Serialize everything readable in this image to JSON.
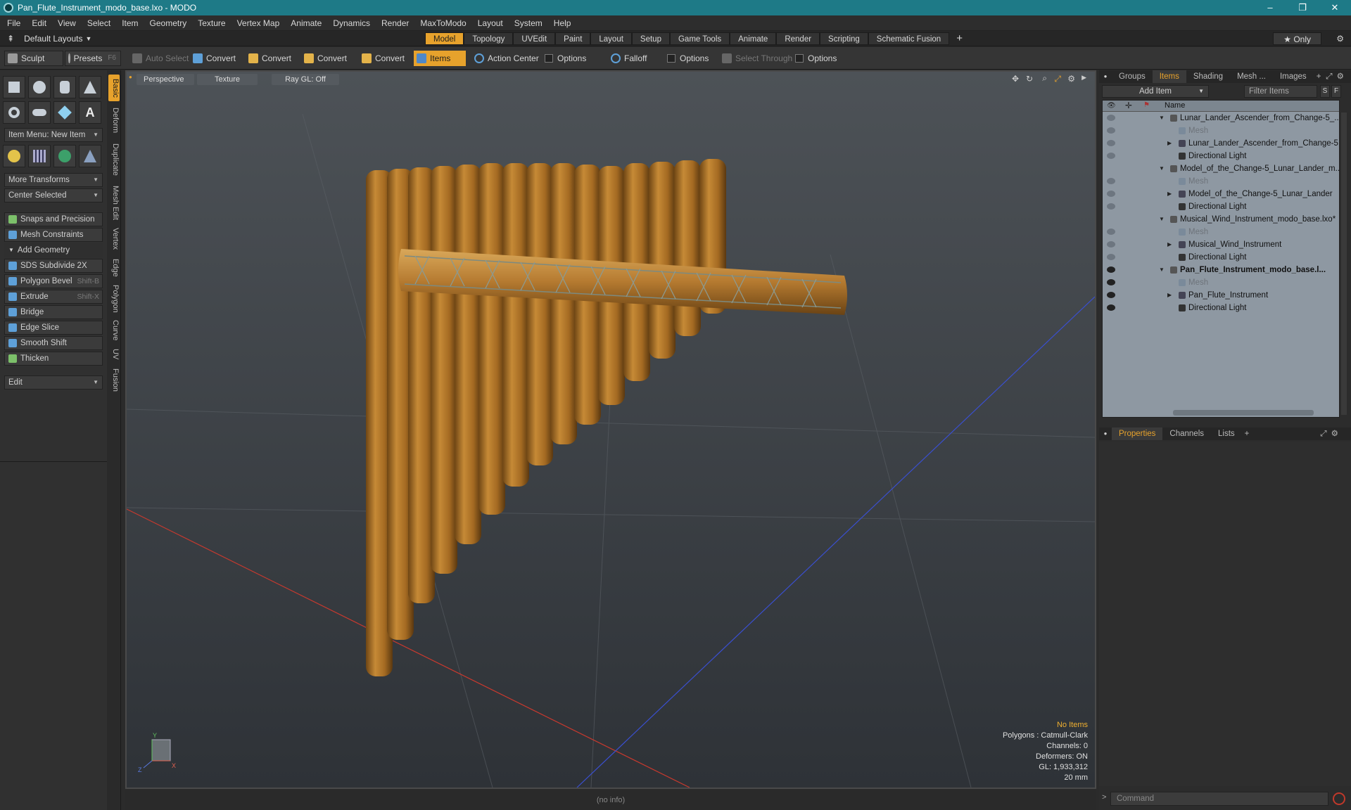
{
  "window": {
    "title": "Pan_Flute_Instrument_modo_base.lxo - MODO",
    "controls": [
      "–",
      "❐",
      "✕"
    ]
  },
  "menu": [
    "File",
    "Edit",
    "View",
    "Select",
    "Item",
    "Geometry",
    "Texture",
    "Vertex Map",
    "Animate",
    "Dynamics",
    "Render",
    "MaxToModo",
    "Layout",
    "System",
    "Help"
  ],
  "layoutbar": {
    "layouts_label": "Default Layouts",
    "tabs": [
      "Model",
      "Topology",
      "UVEdit",
      "Paint",
      "Layout",
      "Setup",
      "Game Tools",
      "Animate",
      "Render",
      "Scripting",
      "Schematic Fusion"
    ],
    "active_tab": "Model",
    "add_symbol": "+",
    "only_label": "★  Only"
  },
  "toolbar": {
    "sculpt": "Sculpt",
    "presets": "Presets",
    "presets_shortcut": "F6",
    "auto_select": "Auto Select",
    "convert": "Convert",
    "items": "Items",
    "action_center": "Action Center",
    "options": "Options",
    "falloff": "Falloff",
    "select_through": "Select Through"
  },
  "leftpanel": {
    "item_menu": "Item Menu: New Item",
    "more_transforms": "More Transforms",
    "center_selected": "Center Selected",
    "snaps": "Snaps and Precision",
    "mesh_constraints": "Mesh Constraints",
    "add_geometry": "Add Geometry",
    "tools": [
      {
        "label": "SDS Subdivide 2X",
        "shortcut": ""
      },
      {
        "label": "Polygon Bevel",
        "shortcut": "Shift-B"
      },
      {
        "label": "Extrude",
        "shortcut": "Shift-X"
      },
      {
        "label": "Bridge",
        "shortcut": ""
      },
      {
        "label": "Edge Slice",
        "shortcut": ""
      },
      {
        "label": "Smooth Shift",
        "shortcut": ""
      },
      {
        "label": "Thicken",
        "shortcut": ""
      }
    ],
    "edit": "Edit",
    "vtabs": [
      "Basic",
      "Deform",
      "Duplicate",
      "Mesh Edit",
      "Vertex",
      "Edge",
      "Polygon",
      "Curve",
      "UV",
      "Fusion"
    ]
  },
  "viewport": {
    "view_mode": "Perspective",
    "shading": "Texture",
    "raygl": "Ray GL: Off",
    "info": {
      "items": "No Items",
      "polygons": "Polygons : Catmull-Clark",
      "channels": "Channels: 0",
      "deformers": "Deformers: ON",
      "gl": "GL: 1,933,312",
      "scale": "20 mm"
    },
    "axis_labels": {
      "x": "X",
      "y": "Y",
      "z": "Z"
    }
  },
  "status": {
    "info": "(no info)"
  },
  "rightpanel": {
    "top_tabs": [
      "Groups",
      "Items",
      "Shading",
      "Mesh ...",
      "Images"
    ],
    "active_top_tab": "Items",
    "add_item": "Add Item",
    "filter_placeholder": "Filter Items",
    "filter_s": "S",
    "filter_f": "F",
    "col_name": "Name",
    "tree": [
      {
        "label": "Lunar_Lander_Ascender_from_Change-5_...",
        "level": 0,
        "type": "scene",
        "eye": "dim",
        "expand": "open"
      },
      {
        "label": "Mesh",
        "level": 1,
        "type": "mesh",
        "eye": "dim",
        "expand": "none",
        "dim": true
      },
      {
        "label": "Lunar_Lander_Ascender_from_Change-5",
        "level": 1,
        "type": "group",
        "eye": "dim",
        "expand": "closed"
      },
      {
        "label": "Directional Light",
        "level": 1,
        "type": "light",
        "eye": "dim",
        "expand": "none"
      },
      {
        "label": "Model_of_the_Change-5_Lunar_Lander_m...",
        "level": 0,
        "type": "scene",
        "eye": "none",
        "expand": "open"
      },
      {
        "label": "Mesh",
        "level": 1,
        "type": "mesh",
        "eye": "dim",
        "expand": "none",
        "dim": true
      },
      {
        "label": "Model_of_the_Change-5_Lunar_Lander",
        "level": 1,
        "type": "group",
        "eye": "dim",
        "expand": "closed"
      },
      {
        "label": "Directional Light",
        "level": 1,
        "type": "light",
        "eye": "dim",
        "expand": "none"
      },
      {
        "label": "Musical_Wind_Instrument_modo_base.lxo*",
        "level": 0,
        "type": "scene",
        "eye": "none",
        "expand": "open"
      },
      {
        "label": "Mesh",
        "level": 1,
        "type": "mesh",
        "eye": "dim",
        "expand": "none",
        "dim": true
      },
      {
        "label": "Musical_Wind_Instrument",
        "level": 1,
        "type": "group",
        "eye": "dim",
        "expand": "closed"
      },
      {
        "label": "Directional Light",
        "level": 1,
        "type": "light",
        "eye": "dim",
        "expand": "none"
      },
      {
        "label": "Pan_Flute_Instrument_modo_base.l...",
        "level": 0,
        "type": "scene",
        "eye": "on",
        "expand": "open",
        "bold": true
      },
      {
        "label": "Mesh",
        "level": 1,
        "type": "mesh",
        "eye": "on",
        "expand": "none",
        "dim": true
      },
      {
        "label": "Pan_Flute_Instrument",
        "level": 1,
        "type": "group",
        "eye": "on",
        "expand": "closed"
      },
      {
        "label": "Directional Light",
        "level": 1,
        "type": "light",
        "eye": "on",
        "expand": "none"
      }
    ],
    "bottom_tabs": [
      "Properties",
      "Channels",
      "Lists"
    ],
    "active_bottom_tab": "Properties",
    "command_placeholder": "Command"
  },
  "colors": {
    "accent": "#e7a22c",
    "titlebar": "#1e7a87",
    "bamboo": "#b07a2c"
  }
}
